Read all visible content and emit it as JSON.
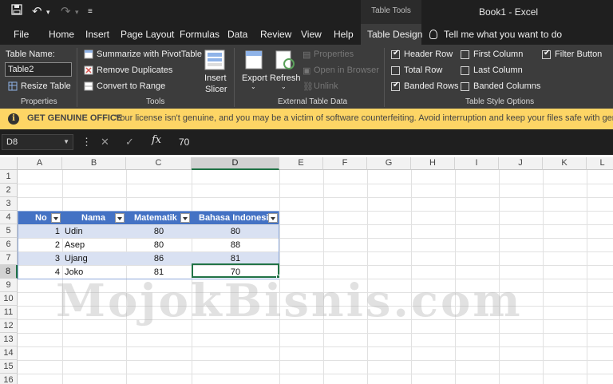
{
  "window": {
    "title": "Book1  -  Excel",
    "context_label": "Table Tools"
  },
  "tabs": [
    "File",
    "Home",
    "Insert",
    "Page Layout",
    "Formulas",
    "Data",
    "Review",
    "View",
    "Help",
    "Table Design"
  ],
  "tell_me": "Tell me what you want to do",
  "ribbon": {
    "properties": {
      "name_label": "Table Name:",
      "name_value": "Table2",
      "resize": "Resize Table",
      "group": "Properties"
    },
    "tools": {
      "summarize": "Summarize with PivotTable",
      "remove_dup": "Remove Duplicates",
      "convert": "Convert to Range",
      "slicer_l1": "Insert",
      "slicer_l2": "Slicer",
      "group": "Tools"
    },
    "external": {
      "export": "Export",
      "refresh": "Refresh",
      "properties": "Properties",
      "open_browser": "Open in Browser",
      "unlink": "Unlink",
      "group": "External Table Data"
    },
    "style_options": {
      "header_row": "Header Row",
      "total_row": "Total Row",
      "banded_rows": "Banded Rows",
      "first_column": "First Column",
      "last_column": "Last Column",
      "banded_columns": "Banded Columns",
      "filter_button": "Filter Button",
      "group": "Table Style Options"
    }
  },
  "infobar": {
    "title": "GET GENUINE OFFICE",
    "message": "Your license isn't genuine, and you may be a victim of software counterfeiting. Avoid interruption and keep your files safe with genuine O"
  },
  "formula_bar": {
    "name_box": "D8",
    "value": "70"
  },
  "grid": {
    "columns": [
      "A",
      "B",
      "C",
      "D",
      "E",
      "F",
      "G",
      "H",
      "I",
      "J",
      "K",
      "L"
    ],
    "rows": [
      "1",
      "2",
      "3",
      "4",
      "5",
      "6",
      "7",
      "8",
      "9",
      "10",
      "11",
      "12",
      "13",
      "14",
      "15",
      "16"
    ],
    "table": {
      "headers": [
        "No",
        "Nama",
        "Matematik",
        "Bahasa Indonesi"
      ],
      "rows": [
        [
          "1",
          "Udin",
          "80",
          "80"
        ],
        [
          "2",
          "Asep",
          "80",
          "88"
        ],
        [
          "3",
          "Ujang",
          "86",
          "81"
        ],
        [
          "4",
          "Joko",
          "81",
          "70"
        ]
      ]
    }
  },
  "watermark": "MojokBisnis.com",
  "colors": {
    "table_header": "#4472c4",
    "band": "#d9e1f2",
    "accent": "#217346",
    "infobar": "#fdd565"
  }
}
